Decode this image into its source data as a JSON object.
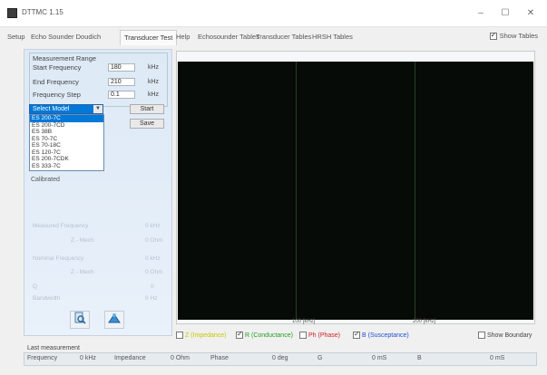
{
  "window": {
    "title": "DTTMC 1.15",
    "minimize": "–",
    "maximize": "☐",
    "close": "✕"
  },
  "tabs": [
    {
      "label": "Setup",
      "active": false
    },
    {
      "label": "Echo Sounder Doudich",
      "active": false
    },
    {
      "label": "Transducer Test",
      "active": true
    },
    {
      "label": "Help",
      "active": false
    },
    {
      "label": "Echosounder Tables",
      "active": false
    },
    {
      "label": "Transducer Tables",
      "active": false
    },
    {
      "label": "HRSH Tables",
      "active": false
    }
  ],
  "show_tables": {
    "label": "Show Tables",
    "checked": true
  },
  "measurement": {
    "group_title": "Measurement Range",
    "start_label": "Start Frequency",
    "start_value": "180",
    "end_label": "End Frequency",
    "end_value": "210",
    "step_label": "Frequency Step",
    "step_value": "0.1",
    "unit": "kHz"
  },
  "transducer_select": {
    "value": "Select Model",
    "arrow": "▼",
    "options": [
      "ES 200-7C",
      "ES 200-7CD",
      "ES 38B",
      "ES 70-7C",
      "ES 70-18C",
      "ES 120-7C",
      "ES 200-7CDK",
      "ES 333-7C"
    ],
    "selected_index": 0
  },
  "buttons": {
    "start": "Start",
    "save": "Save"
  },
  "calibrate_label": "Calibrated",
  "results": {
    "measured_freq_label": "Measured Frequency",
    "measured_freq_unit": "0 kHz",
    "z_label": "Z - Mech",
    "z_unit": "0 Ohm",
    "nominal_freq_label": "Nominal Frequency",
    "nominal_freq_unit": "0 kHz",
    "z2_label": "Z - Mech",
    "z2_unit": "0 Ohm",
    "q_label": "Q",
    "q_value": "0",
    "bw_label": "Bandwidth",
    "bw_value": "0 Hz"
  },
  "bottom_icons": {
    "left": "search-doc-icon",
    "right": "transducer-icon"
  },
  "graph": {
    "axis_label_1": "100 [kHz]",
    "axis_label_2": "200 [kHz]"
  },
  "legend": [
    {
      "label": "Z (Impedance)",
      "color": "#c7c700",
      "checked": false
    },
    {
      "label": "R (Conductance)",
      "color": "#1f9e1f",
      "checked": true
    },
    {
      "label": "Ph (Phase)",
      "color": "#d02020",
      "checked": false
    },
    {
      "label": "B (Susceptance)",
      "color": "#2050d0",
      "checked": true
    }
  ],
  "show_boundary": {
    "label": "Show Boundary",
    "checked": false
  },
  "last_measurement": "Last measurement",
  "status": {
    "frequency_label": "Frequency",
    "frequency_value": "0 kHz",
    "impedance_label": "Impedance",
    "impedance_value": "0 Ohm",
    "phase_label": "Phase",
    "phase_value": "0 deg",
    "g_label": "G",
    "g_value": "0 mS",
    "b_label": "B",
    "b_value": "0 mS"
  }
}
